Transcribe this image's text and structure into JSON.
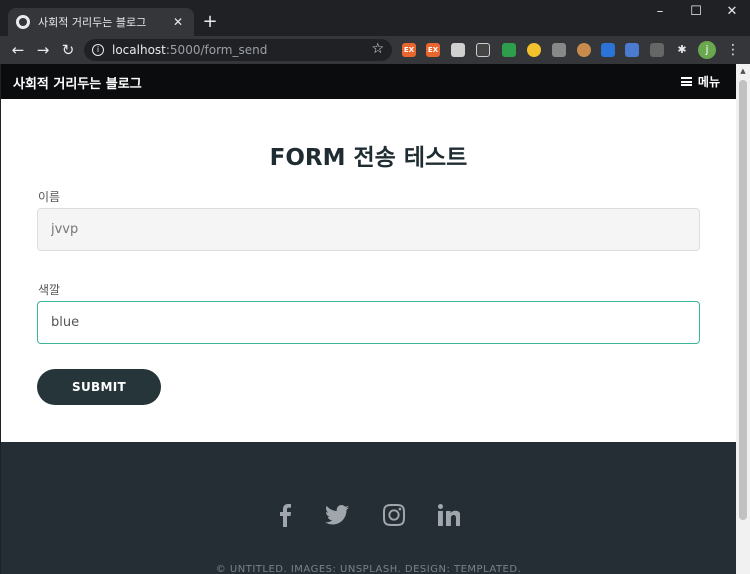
{
  "browser": {
    "tab_title": "사회적 거리두는 블로그",
    "url_host": "localhost",
    "url_path": ":5000/form_send",
    "profile_initial": "j"
  },
  "site": {
    "logo": "사회적 거리두는 블로그",
    "menu_label": "메뉴"
  },
  "form": {
    "title": "FORM 전송 테스트",
    "name_label": "이름",
    "name_value": "jvvp",
    "color_label": "색깔",
    "color_value": "blue",
    "submit_label": "SUBMIT"
  },
  "footer": {
    "copyright": "© UNTITLED.  IMAGES: UNSPLASH.  DESIGN: TEMPLATED."
  },
  "colors": {
    "accent": "#3bb59a",
    "button": "#263539",
    "footer_bg": "#252e35"
  }
}
